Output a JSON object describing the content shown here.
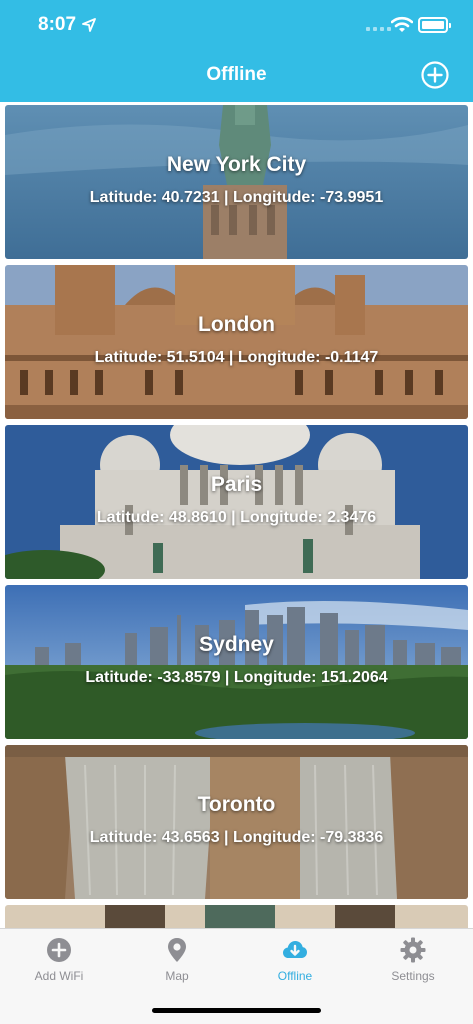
{
  "status_bar": {
    "time": "8:07"
  },
  "header": {
    "title": "Offline",
    "add_icon": "plus-circle-icon",
    "color": "#33bde5"
  },
  "cards": [
    {
      "city": "New York City",
      "coords": "Latitude: 40.7231 | Longitude: -73.9951",
      "image": "statue-of-liberty"
    },
    {
      "city": "London",
      "coords": "Latitude: 51.5104 | Longitude: -0.1147",
      "image": "ornate-building"
    },
    {
      "city": "Paris",
      "coords": "Latitude: 48.8610 | Longitude: 2.3476",
      "image": "sacre-coeur"
    },
    {
      "city": "Sydney",
      "coords": "Latitude: -33.8579 | Longitude: 151.2064",
      "image": "city-skyline"
    },
    {
      "city": "Toronto",
      "coords": "Latitude: 43.6563 | Longitude: -79.3836",
      "image": "waterfall"
    }
  ],
  "tabbar": {
    "tabs": [
      {
        "label": "Add WiFi",
        "icon": "plus-circle-icon"
      },
      {
        "label": "Map",
        "icon": "map-pin-icon"
      },
      {
        "label": "Offline",
        "icon": "cloud-download-icon",
        "active": true
      },
      {
        "label": "Settings",
        "icon": "gear-icon"
      }
    ],
    "active_color": "#33aee0",
    "inactive_color": "#8e8e93"
  }
}
